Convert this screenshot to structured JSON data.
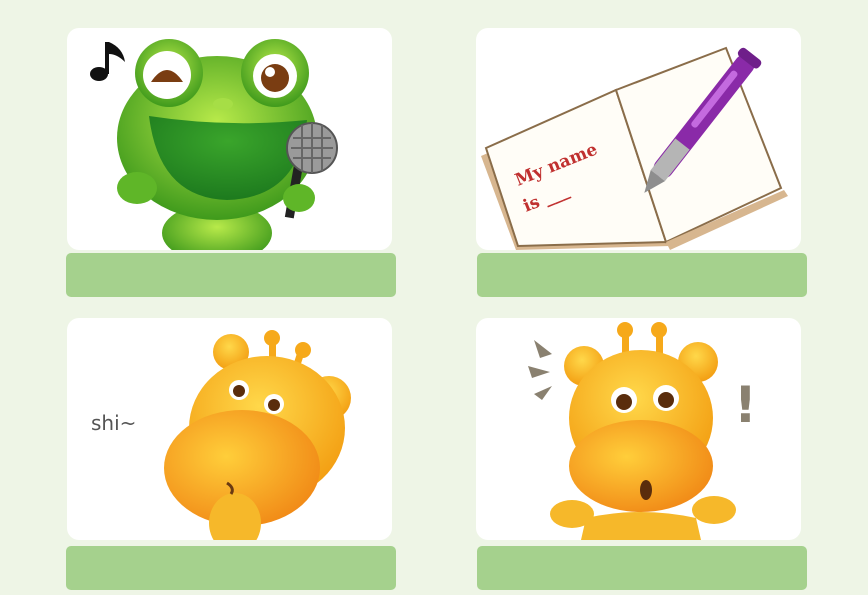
{
  "cards": [
    {
      "illustration": "singing-frog",
      "answer": ""
    },
    {
      "illustration": "notebook-pen",
      "notebook_text_line1": "My name",
      "notebook_text_line2": "is ___",
      "answer": ""
    },
    {
      "illustration": "whispering-giraffe",
      "speech": "shi~",
      "answer": ""
    },
    {
      "illustration": "surprised-giraffe",
      "exclamation": "!",
      "answer": ""
    }
  ],
  "colors": {
    "background": "#eef5e6",
    "card": "#ffffff",
    "answer_bar": "#a5d18d",
    "frog_green": "#6cc62a",
    "giraffe_yellow": "#f7b81e",
    "notebook_red": "#c0302f",
    "pen_purple": "#8a2aa8"
  }
}
